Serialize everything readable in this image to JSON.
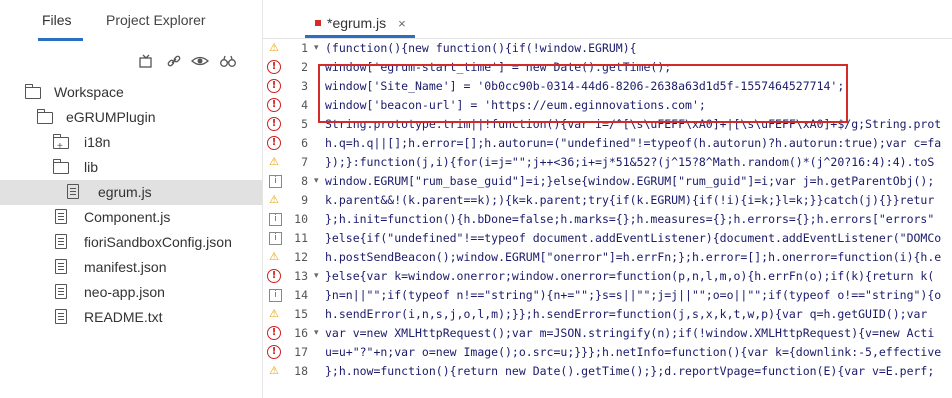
{
  "sidebar": {
    "tabs": [
      "Files",
      "Project Explorer"
    ],
    "active_tab": "Files",
    "toolbar": [
      {
        "name": "collapse-all-icon",
        "glyph": "⇟"
      },
      {
        "name": "link-editor-icon",
        "glyph": "🔗"
      },
      {
        "name": "show-hidden-icon",
        "glyph": "◉"
      },
      {
        "name": "search-files-icon",
        "glyph": "⚇"
      }
    ],
    "tree": [
      {
        "label": "Workspace",
        "icon": "folder-open-icon",
        "depth": 0
      },
      {
        "label": "eGRUMPlugin",
        "icon": "folder-open-icon",
        "depth": 1
      },
      {
        "label": "i18n",
        "icon": "folder-plus-icon",
        "depth": 2
      },
      {
        "label": "lib",
        "icon": "folder-open-icon",
        "depth": 2
      },
      {
        "label": "egrum.js",
        "icon": "file-icon",
        "depth": 3,
        "selected": true
      },
      {
        "label": "Component.js",
        "icon": "file-icon",
        "depth": 2
      },
      {
        "label": "fioriSandboxConfig.json",
        "icon": "file-icon",
        "depth": 2
      },
      {
        "label": "manifest.json",
        "icon": "file-icon",
        "depth": 2
      },
      {
        "label": "neo-app.json",
        "icon": "file-icon",
        "depth": 2
      },
      {
        "label": "README.txt",
        "icon": "file-icon",
        "depth": 2
      }
    ]
  },
  "editor": {
    "tab_label": "*egrum.js",
    "close_glyph": "×",
    "lines": [
      {
        "n": "1",
        "mark": "warn",
        "fold": true,
        "text": "(function(){new function(){if(!window.EGRUM){"
      },
      {
        "n": "2",
        "mark": "err",
        "fold": false,
        "text": "window['egrum-start_time'] = new Date().getTime();"
      },
      {
        "n": "3",
        "mark": "err",
        "fold": false,
        "text": "window['Site_Name'] = '0b0cc90b-0314-44d6-8206-2638a63d1d5f-1557464527714';"
      },
      {
        "n": "4",
        "mark": "err",
        "fold": false,
        "text": "window['beacon-url'] = 'https://eum.eginnovations.com';"
      },
      {
        "n": "5",
        "mark": "err",
        "fold": false,
        "text": "String.prototype.trim||!function(){var i=/^[\\s\\uFEFF\\xA0]+|[\\s\\uFEFF\\xA0]+$/g;String.prot"
      },
      {
        "n": "6",
        "mark": "err",
        "fold": false,
        "text": "h.q=h.q||[];h.error=[];h.autorun=(\"undefined\"!=typeof(h.autorun)?h.autorun:true);var c=fa"
      },
      {
        "n": "7",
        "mark": "warn",
        "fold": false,
        "text": "});}:function(j,i){for(i=j=\"\";j++<36;i+=j*51&52?(j^15?8^Math.random()*(j^20?16:4):4).toS"
      },
      {
        "n": "8",
        "mark": "info",
        "fold": true,
        "text": "window.EGRUM[\"rum_base_guid\"]=i;}else{window.EGRUM[\"rum_guid\"]=i;var j=h.getParentObj();"
      },
      {
        "n": "9",
        "mark": "warn",
        "fold": false,
        "text": "k.parent&&!(k.parent==k);){k=k.parent;try{if(k.EGRUM){if(!i){i=k;}l=k;}}catch(j){}}retur"
      },
      {
        "n": "10",
        "mark": "info",
        "fold": false,
        "text": "};h.init=function(){h.bDone=false;h.marks={};h.measures={};h.errors={};h.errors[\"errors\""
      },
      {
        "n": "11",
        "mark": "info",
        "fold": false,
        "text": "}else{if(\"undefined\"!==typeof document.addEventListener){document.addEventListener(\"DOMCo"
      },
      {
        "n": "12",
        "mark": "warn",
        "fold": false,
        "text": "h.postSendBeacon();window.EGRUM[\"onerror\"]=h.errFn;};h.error=[];h.onerror=function(i){h.e"
      },
      {
        "n": "13",
        "mark": "err",
        "fold": true,
        "text": "}else{var k=window.onerror;window.onerror=function(p,n,l,m,o){h.errFn(o);if(k){return k("
      },
      {
        "n": "14",
        "mark": "info",
        "fold": false,
        "text": "}n=n||\"\";if(typeof n!==\"string\"){n+=\"\";}s=s||\"\";j=j||\"\";o=o||\"\";if(typeof o!==\"string\"){o"
      },
      {
        "n": "15",
        "mark": "warn",
        "fold": false,
        "text": "h.sendError(i,n,s,j,o,l,m);}};h.sendError=function(j,s,x,k,t,w,p){var q=h.getGUID();var"
      },
      {
        "n": "16",
        "mark": "err",
        "fold": true,
        "text": "var v=new XMLHttpRequest();var m=JSON.stringify(n);if(!window.XMLHttpRequest){v=new Acti"
      },
      {
        "n": "17",
        "mark": "err",
        "fold": false,
        "text": "u=u+\"?\"+n;var o=new Image();o.src=u;}}};h.netInfo=function(){var k={downlink:-5,effective"
      },
      {
        "n": "18",
        "mark": "warn",
        "fold": false,
        "text": "};h.now=function(){return new Date().getTime();};d.reportVpage=function(E){var v=E.perf;"
      }
    ]
  }
}
